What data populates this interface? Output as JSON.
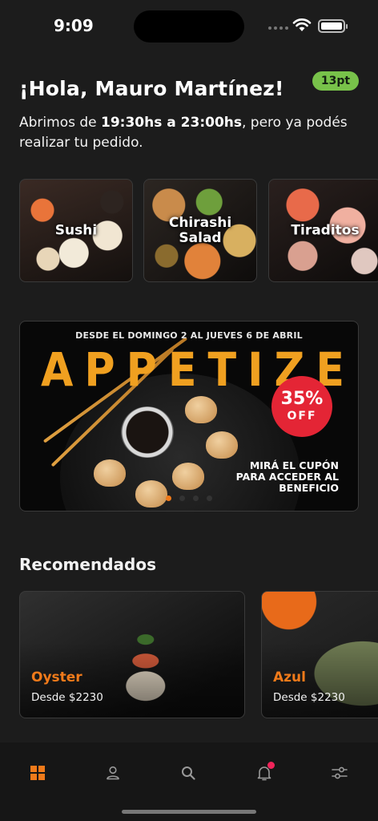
{
  "status_bar": {
    "time": "9:09"
  },
  "header": {
    "greeting": "¡Hola, Mauro Martínez!",
    "points": "13pt",
    "message_prefix": "Abrimos de ",
    "message_hours": "19:30hs a 23:00hs",
    "message_suffix": ", pero ya podés realizar tu pedido."
  },
  "categories": [
    {
      "label": "Sushi"
    },
    {
      "label": "Chirashi Salad"
    },
    {
      "label": "Tiraditos"
    }
  ],
  "promo_banner": {
    "dates": "DESDE EL DOMINGO 2 AL JUEVES 6 DE ABRIL",
    "title": "APPETIZER",
    "discount": "35%",
    "discount_suffix": "OFF",
    "cta": "MIRÁ EL CUPÓN PARA ACCEDER AL BENEFICIO",
    "slides": 4,
    "active_slide": 1
  },
  "recommended": {
    "title": "Recomendados",
    "items": [
      {
        "name": "Oyster",
        "price": "Desde $2230"
      },
      {
        "name": "Azul",
        "price": "Desde $2230"
      }
    ]
  },
  "tab_bar": {
    "items": [
      "home-icon",
      "user-icon",
      "search-icon",
      "bell-icon",
      "filters-icon"
    ],
    "active": "home-icon",
    "accent": "#f07a1a",
    "badge_color": "#f0245a"
  }
}
